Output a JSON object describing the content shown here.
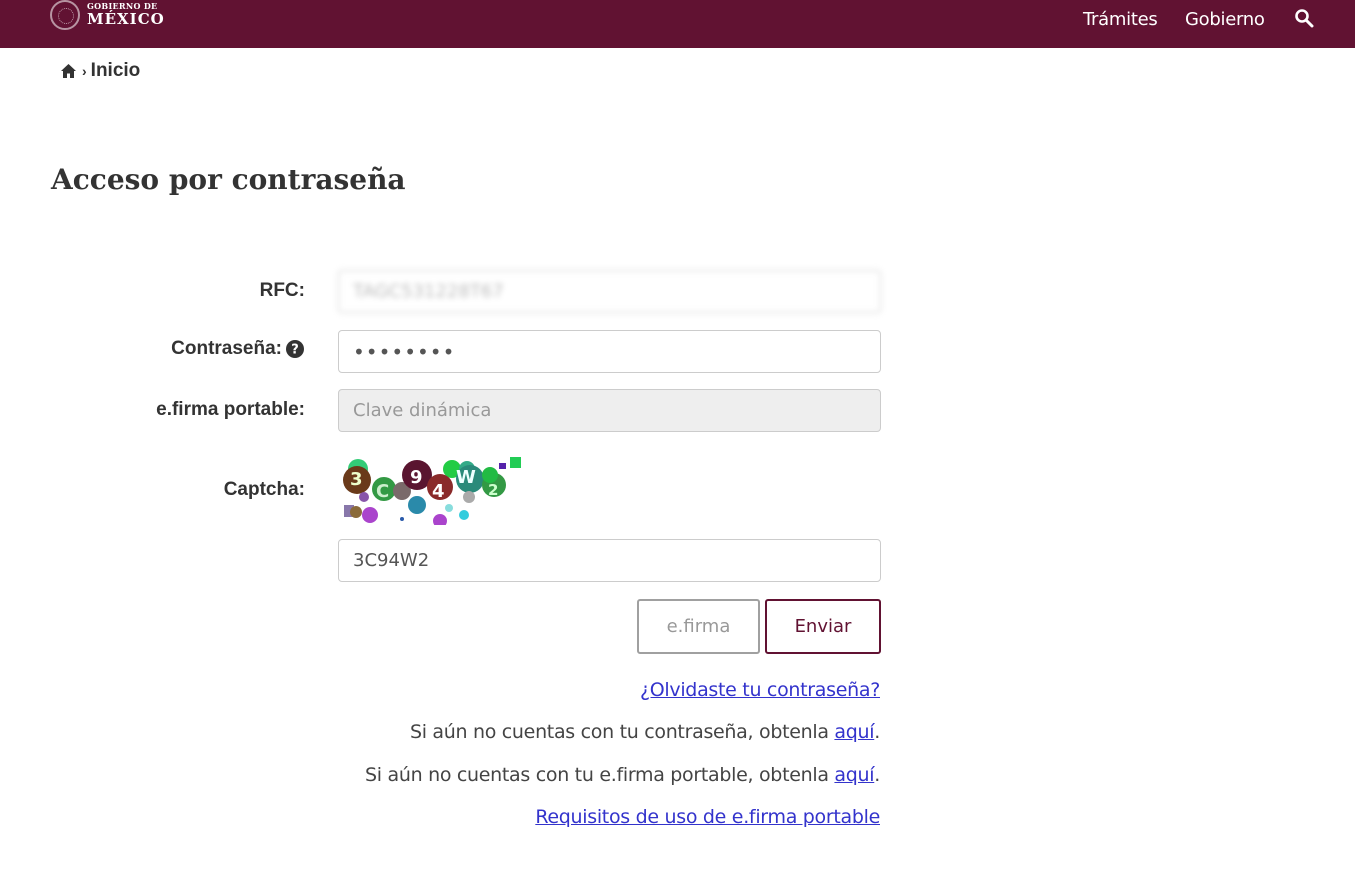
{
  "header": {
    "logo_small": "GOBIERNO DE",
    "logo_big": "MÉXICO",
    "nav": [
      "Trámites",
      "Gobierno"
    ],
    "bg_color": "#611232"
  },
  "breadcrumb": {
    "current": "Inicio",
    "separator": "›"
  },
  "page_title": "Acceso por contraseña",
  "form": {
    "rfc_label": "RFC:",
    "rfc_value": "TAGC531228T67",
    "password_label": "Contraseña:",
    "password_value": "••••••••",
    "efirma_label": "e.firma portable:",
    "efirma_placeholder": "Clave dinámica",
    "captcha_label": "Captcha:",
    "captcha_value": "3C94W2",
    "btn_efirma": "e.firma",
    "btn_enviar": "Enviar"
  },
  "links": {
    "forgot": "¿Olvidaste tu contraseña?",
    "line1_text": "Si aún no cuentas con tu contraseña, obtenla ",
    "line1_link": "aquí",
    "line2_text": "Si aún no cuentas con tu e.firma portable, obtenla ",
    "line2_link": "aquí",
    "period": ".",
    "requisitos": "Requisitos de uso de e.firma portable"
  },
  "icons": [
    "seal-icon",
    "search-icon",
    "home-icon",
    "help-icon"
  ]
}
